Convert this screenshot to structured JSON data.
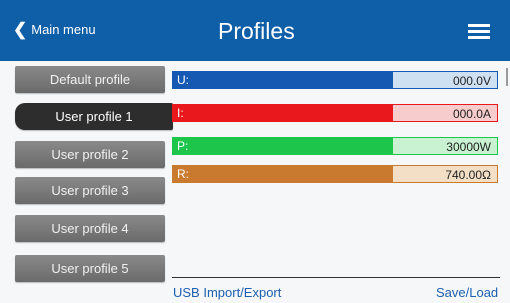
{
  "header": {
    "back_label": "Main menu",
    "title": "Profiles",
    "menu_icon": "hamburger-menu-icon",
    "back_icon": "chevron-left-icon"
  },
  "sidebar": {
    "items": [
      {
        "label": "Default profile",
        "selected": false
      },
      {
        "label": "User profile 1",
        "selected": true
      },
      {
        "label": "User profile 2",
        "selected": false
      },
      {
        "label": "User profile 3",
        "selected": false
      },
      {
        "label": "User profile 4",
        "selected": false
      },
      {
        "label": "User profile 5",
        "selected": false
      }
    ]
  },
  "values": [
    {
      "name": "U:",
      "value": "000.0V",
      "bar_color": "#1559b3",
      "value_bg": "#cfe0f2"
    },
    {
      "name": "I:",
      "value": "000.0A",
      "bar_color": "#e8181c",
      "value_bg": "#f7cccc"
    },
    {
      "name": "P:",
      "value": "30000W",
      "bar_color": "#1dc54a",
      "value_bg": "#c9f2d3"
    },
    {
      "name": "R:",
      "value": "740.00Ω",
      "bar_color": "#c97a2f",
      "value_bg": "#f3dfc6"
    }
  ],
  "footer": {
    "usb_label": "USB Import/Export",
    "save_label": "Save/Load"
  }
}
